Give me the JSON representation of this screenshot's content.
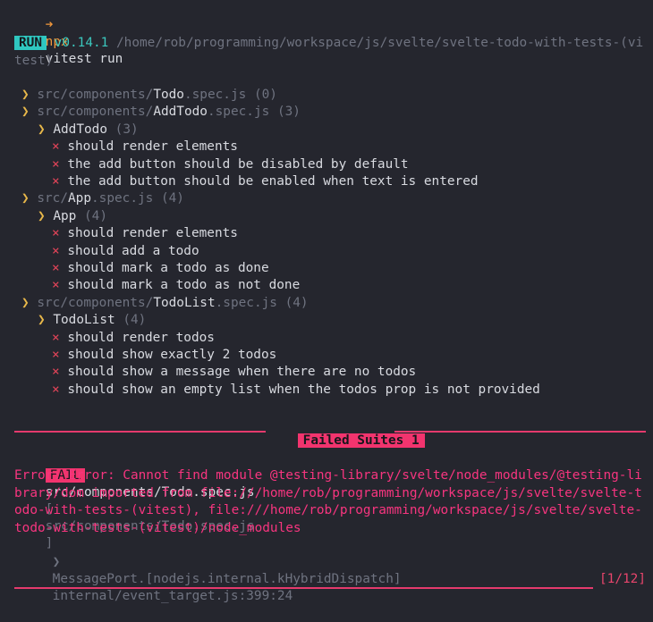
{
  "prompt": {
    "arrow": "➜",
    "command": "npx",
    "args": "vitest run"
  },
  "run": {
    "badge": "RUN",
    "version": "v0.14.1",
    "path": "/home/rob/programming/workspace/js/svelte/svelte-todo-with-tests-(vitest)"
  },
  "tree": [
    {
      "chev": "❯",
      "dir": "src/components/",
      "file": "Todo",
      "ext": ".spec.js",
      "count": "(0)"
    },
    {
      "chev": "❯",
      "dir": "src/components/",
      "file": "AddTodo",
      "ext": ".spec.js",
      "count": "(3)"
    },
    {
      "chev": "❯",
      "suite": "AddTodo",
      "count": "(3)"
    },
    {
      "mark": "×",
      "test": "should render elements"
    },
    {
      "mark": "×",
      "test": "the add button should be disabled by default"
    },
    {
      "mark": "×",
      "test": "the add button should be enabled when text is entered"
    },
    {
      "chev": "❯",
      "dir": "src/",
      "file": "App",
      "ext": ".spec.js",
      "count": "(4)"
    },
    {
      "chev": "❯",
      "suite": "App",
      "count": "(4)"
    },
    {
      "mark": "×",
      "test": "should render elements"
    },
    {
      "mark": "×",
      "test": "should add a todo"
    },
    {
      "mark": "×",
      "test": "should mark a todo as done"
    },
    {
      "mark": "×",
      "test": "should mark a todo as not done"
    },
    {
      "chev": "❯",
      "dir": "src/components/",
      "file": "TodoList",
      "ext": ".spec.js",
      "count": "(4)"
    },
    {
      "chev": "❯",
      "suite": "TodoList",
      "count": "(4)"
    },
    {
      "mark": "×",
      "test": "should render todos"
    },
    {
      "mark": "×",
      "test": "should show exactly 2 todos"
    },
    {
      "mark": "×",
      "test": "should show a message when there are no todos"
    },
    {
      "mark": "×",
      "test": "should show an empty list when the todos prop is not provided"
    }
  ],
  "failed_suites": {
    "label": "Failed Suites 1"
  },
  "fail": {
    "badge": "FAIL",
    "file": "src/components/Todo.spec.js",
    "bracket_open": "[",
    "bracket_file": "src/components/Todo.spec.js",
    "bracket_close": "]",
    "error": "Error: Error: Cannot find module @testing-library/svelte/node_modules/@testing-library/dom imported from file:///home/rob/programming/workspace/js/svelte/svelte-todo-with-tests-(vitest), file:///home/rob/programming/workspace/js/svelte/svelte-todo-with-tests-(vitest)/node_modules",
    "stack_chev": "❯",
    "stack_fn": "MessagePort.[nodejs.internal.kHybridDispatch]",
    "stack_loc": "internal/event_target.js:399:24"
  },
  "pager": {
    "counter": "[1/12]"
  }
}
